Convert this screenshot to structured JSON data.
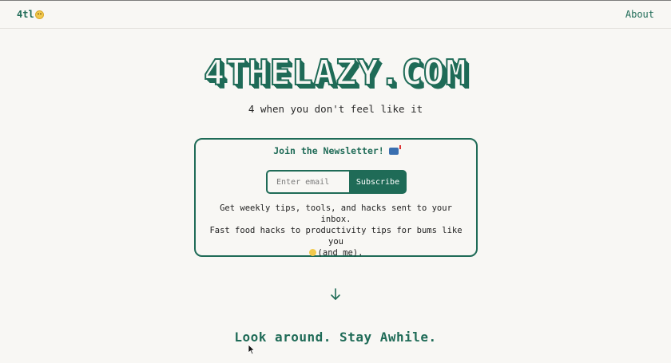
{
  "nav": {
    "brand": "4tl",
    "brand_icon": "sleepy-face-icon",
    "about": "About"
  },
  "hero": {
    "title": "4THELAZY.COM",
    "tagline": "4 when you don't feel like it"
  },
  "newsletter": {
    "title": "Join the Newsletter!",
    "title_icon": "mailbox-icon",
    "input_placeholder": "Enter email",
    "input_value": "",
    "subscribe_label": "Subscribe",
    "description_line1": "Get weekly tips, tools, and hacks sent to your inbox.",
    "description_line2": "Fast food hacks to productivity tips for bums like you",
    "description_line3": "(and me)."
  },
  "scroll_icon": "arrow-down-icon",
  "section": {
    "title": "Look around. Stay Awhile."
  },
  "colors": {
    "accent": "#1f6b57",
    "background": "#f8f7f4"
  }
}
